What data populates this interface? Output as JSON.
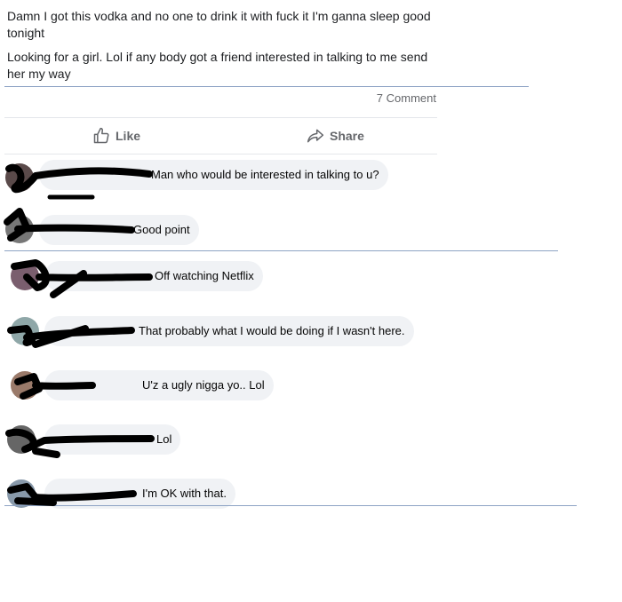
{
  "post": {
    "line1": "Damn I got this vodka and no one to drink it with fuck it I'm ganna sleep good tonight",
    "line2": "Looking for a girl. Lol if any body got a friend interested in talking to me send her my way"
  },
  "stats": {
    "comment_count": "7 Comment"
  },
  "actions": {
    "like_label": "Like",
    "share_label": "Share"
  },
  "comments": [
    {
      "text": "Man who would be interested in talking to u?"
    },
    {
      "text": "Good point"
    },
    {
      "text": "Off watching Netflix"
    },
    {
      "text": "That probably what I would be doing if I wasn't here."
    },
    {
      "text": "U'z a ugly nigga yo.. Lol"
    },
    {
      "text": "Lol"
    },
    {
      "text": "I'm OK with that."
    }
  ],
  "colors": {
    "bubble": "#f0f2f5",
    "meta_text": "#65676b",
    "name_link": "#385898",
    "divider": "#8da3c4",
    "redaction": "#000000"
  },
  "icons": {
    "like": "thumbs-up-icon",
    "share": "share-arrow-icon"
  }
}
